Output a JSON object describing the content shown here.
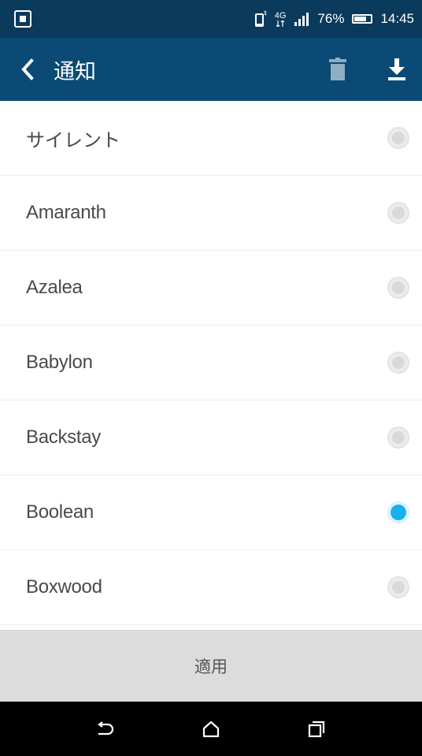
{
  "status_bar": {
    "signal_text": "4G",
    "battery_percent": "76%",
    "time": "14:45",
    "battery_level": 0.76,
    "icons": [
      "notification-icon",
      "phone-vibrate-icon",
      "data-4g-icon",
      "signal-icon",
      "battery-icon"
    ]
  },
  "app_bar": {
    "back_icon": "chevron-left-icon",
    "title": "通知",
    "actions": [
      "trash-icon",
      "download-icon"
    ]
  },
  "ringtones": {
    "items": [
      {
        "label": "サイレント",
        "selected": false
      },
      {
        "label": "Amaranth",
        "selected": false
      },
      {
        "label": "Azalea",
        "selected": false
      },
      {
        "label": "Babylon",
        "selected": false
      },
      {
        "label": "Backstay",
        "selected": false
      },
      {
        "label": "Boolean",
        "selected": true
      },
      {
        "label": "Boxwood",
        "selected": false
      }
    ]
  },
  "apply": {
    "label": "適用"
  },
  "nav_bar": {
    "icons": [
      "back-icon",
      "home-icon",
      "recents-icon"
    ]
  },
  "colors": {
    "status_bar": "#0a3a5c",
    "app_bar": "#0a4a75",
    "accent": "#1ab0ee",
    "apply_bar": "#dcdcdc"
  }
}
